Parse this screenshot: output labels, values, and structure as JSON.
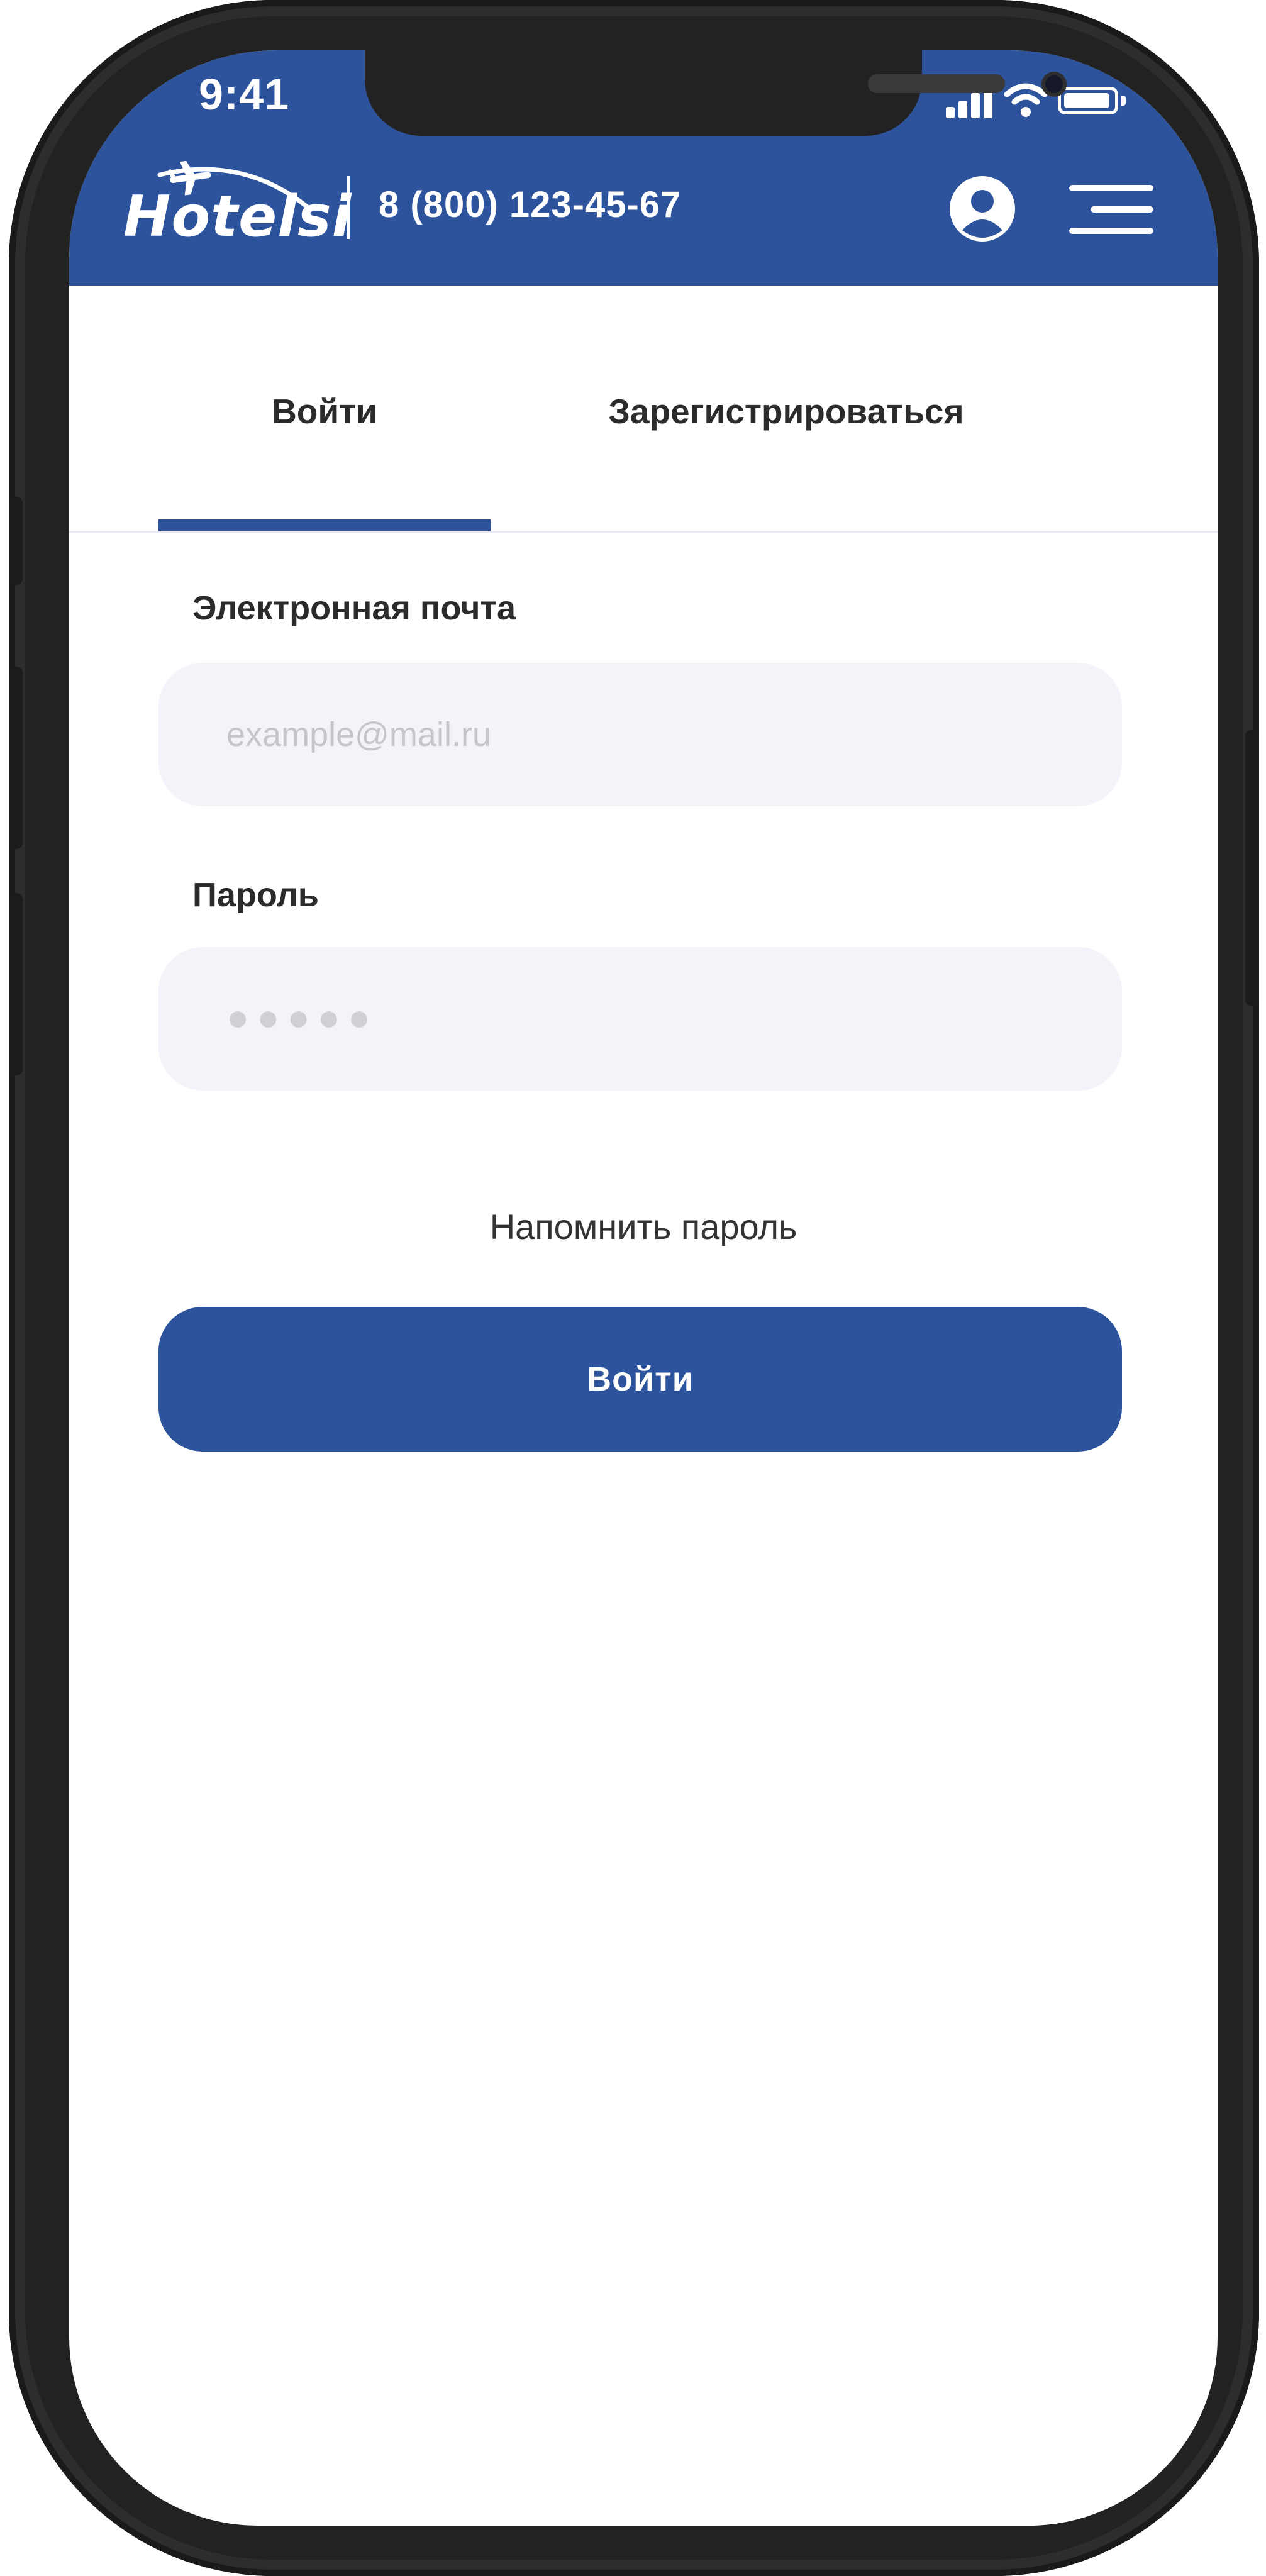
{
  "status_bar": {
    "time": "9:41",
    "icons": [
      "signal-icon",
      "wifi-icon",
      "battery-icon"
    ]
  },
  "header": {
    "logo_text": "Hotelsi",
    "phone": "8 (800) 123-45-67",
    "icons": [
      "airplane-icon",
      "user-icon",
      "menu-icon"
    ]
  },
  "tabs": [
    {
      "label": "Войти",
      "active": true
    },
    {
      "label": "Зарегистрироваться",
      "active": false
    }
  ],
  "form": {
    "email_label": "Электронная почта",
    "email_placeholder": "example@mail.ru",
    "password_label": "Пароль",
    "password_placeholder": "●●●●●",
    "remind_link": "Напомнить пароль",
    "submit_label": "Войти"
  },
  "colors": {
    "brand": "#2c539b",
    "field_bg": "#f3f4f9",
    "text": "#2b2b2b",
    "placeholder": "#c4c6cc"
  }
}
